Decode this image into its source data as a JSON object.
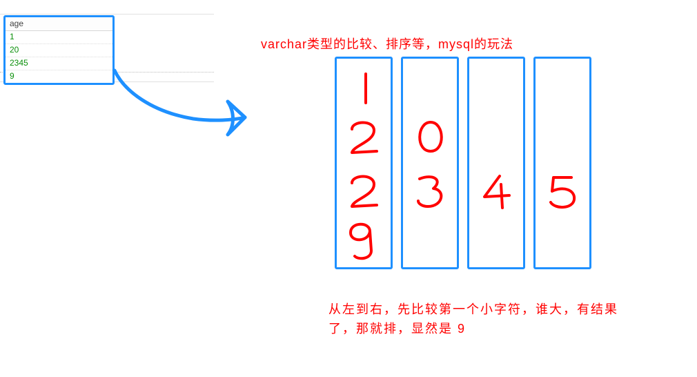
{
  "table": {
    "header": "age",
    "rows": [
      "1",
      "20",
      "2345",
      "9"
    ]
  },
  "title": "varchar类型的比较、排序等，mysql的玩法",
  "columns": [
    {
      "digits": [
        "1",
        "2",
        "2",
        "9"
      ]
    },
    {
      "digits": [
        "",
        "0",
        "3",
        ""
      ]
    },
    {
      "digits": [
        "",
        "",
        "4",
        ""
      ]
    },
    {
      "digits": [
        "",
        "",
        "5",
        ""
      ]
    }
  ],
  "bottom_line1": "从左到右，先比较第一个小字符，谁大，有结果",
  "bottom_line2": "了，那就排，显然是 9",
  "colors": {
    "box_border": "#1e90ff",
    "text_red": "#ff0000",
    "value_green": "#0a8f0a"
  }
}
